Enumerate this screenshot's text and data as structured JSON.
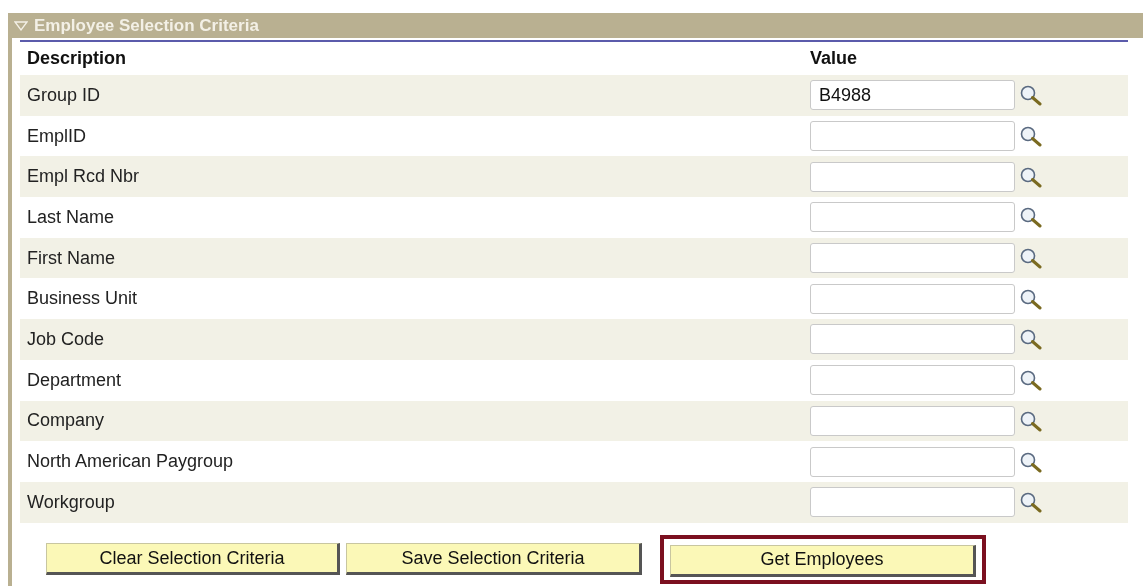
{
  "section": {
    "title": "Employee Selection Criteria",
    "expanded": true
  },
  "table": {
    "columns": [
      "Description",
      "Value"
    ],
    "rows": [
      {
        "label": "Group ID",
        "value": "B4988"
      },
      {
        "label": "EmplID",
        "value": ""
      },
      {
        "label": "Empl Rcd Nbr",
        "value": ""
      },
      {
        "label": "Last Name",
        "value": ""
      },
      {
        "label": "First Name",
        "value": ""
      },
      {
        "label": "Business Unit",
        "value": ""
      },
      {
        "label": "Job Code",
        "value": ""
      },
      {
        "label": "Department",
        "value": ""
      },
      {
        "label": "Company",
        "value": ""
      },
      {
        "label": "North American Paygroup",
        "value": ""
      },
      {
        "label": "Workgroup",
        "value": ""
      }
    ]
  },
  "buttons": [
    {
      "label": "Clear Selection Criteria",
      "highlighted": false
    },
    {
      "label": "Save Selection Criteria",
      "highlighted": false
    },
    {
      "label": "Get Employees",
      "highlighted": true
    }
  ]
}
